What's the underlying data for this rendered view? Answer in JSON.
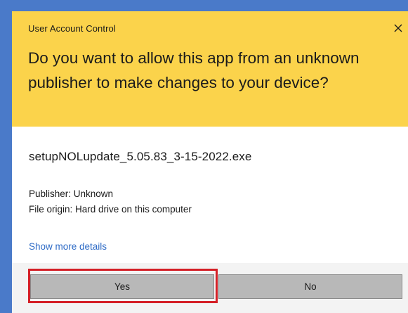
{
  "dialog": {
    "title": "User Account Control",
    "question": "Do you want to allow this app from an unknown publisher to make changes to your device?",
    "app_name": "setupNOLupdate_5.05.83_3-15-2022.exe",
    "publisher": "Publisher: Unknown",
    "file_origin": "File origin: Hard drive on this computer",
    "details_link": "Show more details",
    "close_icon": "close-icon"
  },
  "buttons": {
    "yes_label": "Yes",
    "no_label": "No"
  },
  "colors": {
    "background": "#4a7ac9",
    "header": "#fbd34b",
    "link": "#2e6bc6",
    "button": "#b8b8b8",
    "highlight": "#d41f26"
  }
}
